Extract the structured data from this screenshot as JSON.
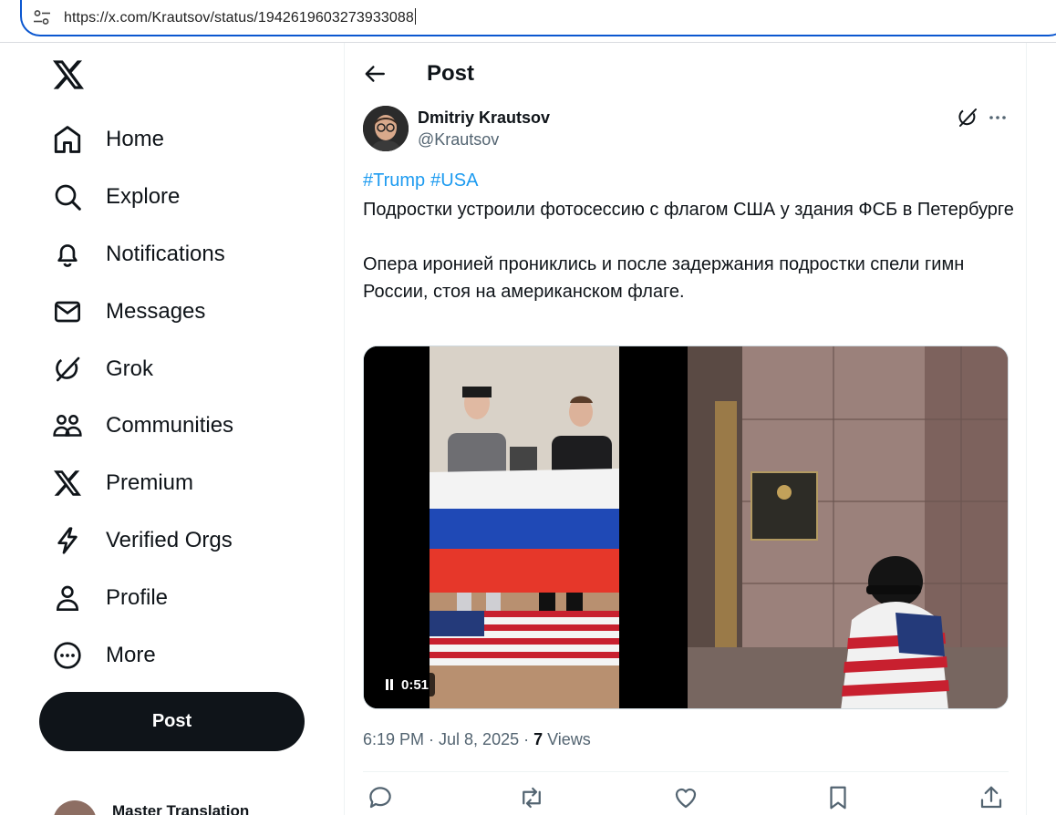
{
  "browser": {
    "url": "https://x.com/Krautsov/status/1942619603273933088"
  },
  "nav": {
    "items": [
      {
        "label": "Home",
        "icon": "home-icon"
      },
      {
        "label": "Explore",
        "icon": "search-icon"
      },
      {
        "label": "Notifications",
        "icon": "bell-icon"
      },
      {
        "label": "Messages",
        "icon": "envelope-icon"
      },
      {
        "label": "Grok",
        "icon": "grok-icon"
      },
      {
        "label": "Communities",
        "icon": "communities-icon"
      },
      {
        "label": "Premium",
        "icon": "x-logo-icon"
      },
      {
        "label": "Verified Orgs",
        "icon": "lightning-icon"
      },
      {
        "label": "Profile",
        "icon": "person-icon"
      },
      {
        "label": "More",
        "icon": "more-circle-icon"
      }
    ],
    "post_button": "Post",
    "account_name": "Master Translation"
  },
  "header": {
    "title": "Post"
  },
  "tweet": {
    "author_name": "Dmitriy Krautsov",
    "author_handle": "@Krautsov",
    "hashtags": [
      "#Trump",
      "#USA"
    ],
    "paragraph1": "Подростки устроили фотосессию с флагом США у здания ФСБ в Петербурге",
    "paragraph2": "Опера иронией прониклись и после задержания подростки спели гимн России, стоя на американском флаге.",
    "video_time": "0:51",
    "timestamp": "6:19 PM · Jul 8, 2025 · ",
    "views_count": "7",
    "views_label": " Views"
  },
  "colors": {
    "accent": "#1d9bf0",
    "text": "#0f1419",
    "muted": "#536471",
    "url_border": "#0b57d0"
  }
}
